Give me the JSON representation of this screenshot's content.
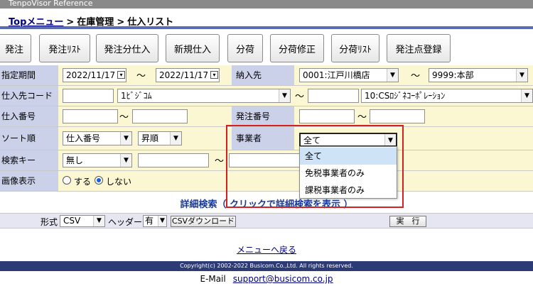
{
  "window": {
    "title": "TenpoVisor Reference"
  },
  "breadcrumb": {
    "top": "Topメニュー",
    "sep": ">",
    "level2": "在庫管理",
    "level3": "仕入リスト"
  },
  "toolbar": {
    "buttons": [
      "発注",
      "発注ﾘｽﾄ",
      "発注分仕入",
      "新規仕入",
      "分荷",
      "分荷修正",
      "分荷ﾘｽﾄ",
      "発注点登録"
    ]
  },
  "form": {
    "period": {
      "label": "指定期間",
      "from": "2022/11/17",
      "tilde": "〜",
      "to": "2022/11/17"
    },
    "delivery": {
      "label": "納入先",
      "from": "0001:江戸川橋店",
      "tilde": "〜",
      "to": "9999:本部"
    },
    "supplier": {
      "label": "仕入先コード",
      "code_from": "",
      "from": "1ﾋﾞｼﾞｺﾑ",
      "tilde": "〜",
      "code_to": "",
      "to": "10:CSﾛｼﾞﾈｺｰﾎﾟﾚｰｼｮﾝ"
    },
    "purchase_no": {
      "label": "仕入番号",
      "from": "",
      "tilde": "〜",
      "to": ""
    },
    "order_no": {
      "label": "発注番号",
      "from": "",
      "tilde": "〜",
      "to": ""
    },
    "sort": {
      "label": "ソート順",
      "key": "仕入番号",
      "dir": "昇順"
    },
    "business": {
      "label": "事業者",
      "value": "全て"
    },
    "search_key": {
      "label": "検索キー",
      "value": "無し",
      "input_from": "",
      "tilde": "〜",
      "input_to": ""
    },
    "image": {
      "label": "画像表示",
      "opt_yes": "する",
      "opt_no": "しない",
      "selected": "しない"
    }
  },
  "business_dropdown": {
    "options": [
      "全て",
      "免税事業者のみ",
      "課税事業者のみ"
    ],
    "highlighted": "全て"
  },
  "detail_search": "詳細検索（ クリックで詳細検索を表示 ）",
  "export": {
    "format_label": "形式",
    "format": "CSV",
    "header_label": "ヘッダー",
    "header": "有",
    "download_label": "CSVダウンロード",
    "run_label": "実　行"
  },
  "menu_back": "メニューへ戻る",
  "footer": {
    "copyright": "Copyright(c) 2002-2022 Busicom.Co.,Ltd. All rights reserved."
  },
  "contact": {
    "label": "E-Mail",
    "email": "support@busicom.co.jp"
  },
  "colors": {
    "label_bg": "#ccd1ea",
    "row_bg": "#fbf7d2",
    "footer_bg": "#2c3a76",
    "highlight_box": "#d42020"
  }
}
